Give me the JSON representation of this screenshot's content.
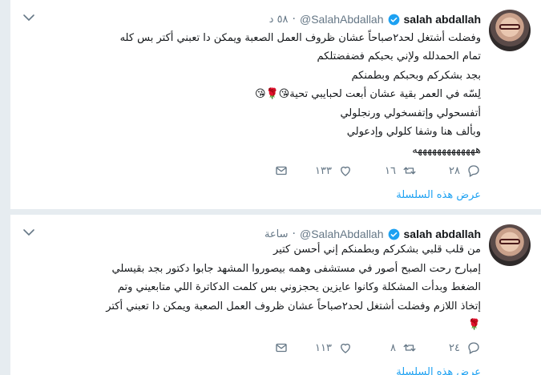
{
  "colors": {
    "accent": "#1da1f2",
    "muted": "#657786",
    "text": "#14171a",
    "heart": "#657786"
  },
  "tweets": [
    {
      "fullname": "salah abdallah",
      "handle": "@SalahAbdallah",
      "dot": "·",
      "time": "٥٨ د",
      "lines": [
        "وفضلت أشتغل لحد٢صباحاً عشان ظروف العمل الصعبة ويمكن دا تعبني أكتر بس كله",
        "تمام الحمدلله ولإني بحبكم فضفضتلكم",
        "بجد بشكركم وبحبكم وبطمنكم",
        "لِسّه في العمر بقية عشان أبعت لحبايبي تحية😘🌹😘",
        "أتفسحولي وإتفسخولي ورنجلولي",
        "وبألف هنا وشفا كلولي وإدعولي",
        "هههههههههههههه"
      ],
      "actions": {
        "reply_count": "٢٨",
        "retweet_count": "١٦",
        "like_count": "١٣٣"
      },
      "thread_link": "عرض هذه السلسلة"
    },
    {
      "fullname": "salah abdallah",
      "handle": "@SalahAbdallah",
      "dot": "·",
      "time": "ساعة",
      "lines": [
        "من قلب قلبي بشكركم وبطمنكم إني أحسن كتير",
        "إمبارح رحت الصبح أصور في مستشفى وهمه بيصوروا المشهد جابوا دكتور بجد بقيسلي",
        "الضغط وبدأت المشكلة وكانوا عايزين يحجزوني بس كلمت الدكاترة اللي متابعيني وتم",
        "إتخاذ اللازم وفضلت أشتغل لحد٢صباحاً عشان ظروف العمل الصعبة ويمكن دا تعبني أكتر",
        "🌹"
      ],
      "actions": {
        "reply_count": "٢٤",
        "retweet_count": "٨",
        "like_count": "١١٣"
      },
      "thread_link": "عرض هذه السلسلة"
    }
  ]
}
